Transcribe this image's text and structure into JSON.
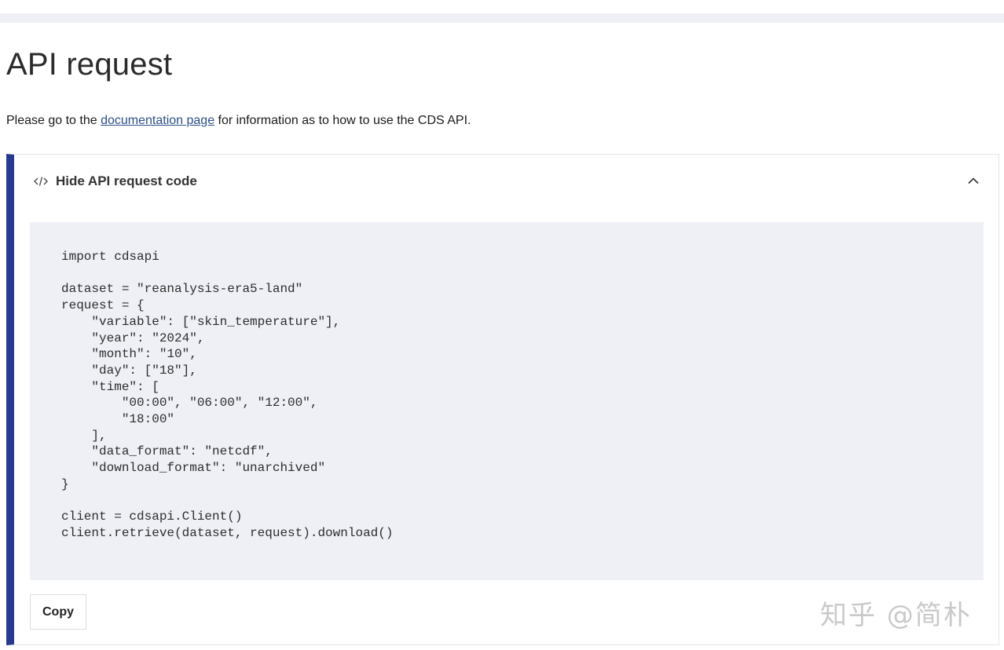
{
  "page": {
    "title": "API request",
    "intro": {
      "before": "Please go to the ",
      "link": "documentation page",
      "after": " for information as to how to use the CDS API."
    }
  },
  "panel": {
    "toggle_label": "Hide API request code",
    "toggle_icon": "code-brackets-icon",
    "collapse_icon": "chevron-up-icon",
    "accent_color": "#263b8f",
    "code": "import cdsapi\n\ndataset = \"reanalysis-era5-land\"\nrequest = {\n    \"variable\": [\"skin_temperature\"],\n    \"year\": \"2024\",\n    \"month\": \"10\",\n    \"day\": [\"18\"],\n    \"time\": [\n        \"00:00\", \"06:00\", \"12:00\",\n        \"18:00\"\n    ],\n    \"data_format\": \"netcdf\",\n    \"download_format\": \"unarchived\"\n}\n\nclient = cdsapi.Client()\nclient.retrieve(dataset, request).download()",
    "copy_label": "Copy"
  },
  "watermark": "知乎 @简朴"
}
